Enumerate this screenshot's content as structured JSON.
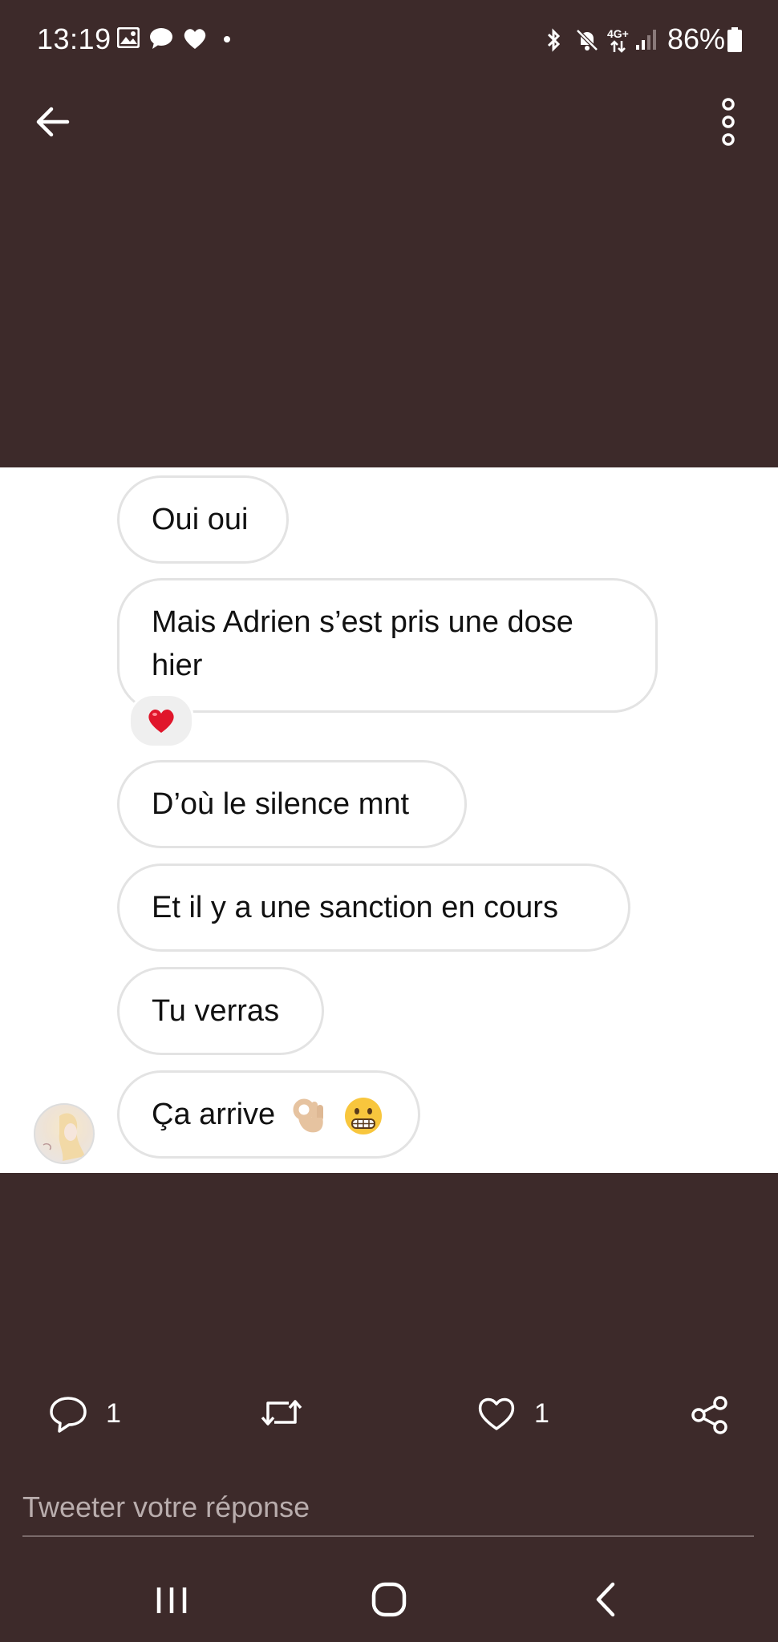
{
  "status": {
    "time": "13:19",
    "network": "4G+",
    "battery": "86%"
  },
  "conversation": {
    "messages": [
      {
        "text": "Oui oui"
      },
      {
        "text": "Mais Adrien s’est pris une dose hier",
        "reaction": "heart-emoji"
      },
      {
        "text": "D’où le silence mnt"
      },
      {
        "text": "Et il y a une sanction en cours"
      },
      {
        "text": "Tu verras"
      },
      {
        "text": "Ça arrive",
        "emojis": [
          "ok-hand-emoji",
          "grimacing-face-emoji"
        ]
      }
    ]
  },
  "tweet_actions": {
    "reply_count": "1",
    "like_count": "1"
  },
  "reply": {
    "placeholder": "Tweeter votre réponse"
  },
  "colors": {
    "background": "#3d2a2a",
    "bubble_border": "#e3e3e3",
    "text": "#111111"
  }
}
